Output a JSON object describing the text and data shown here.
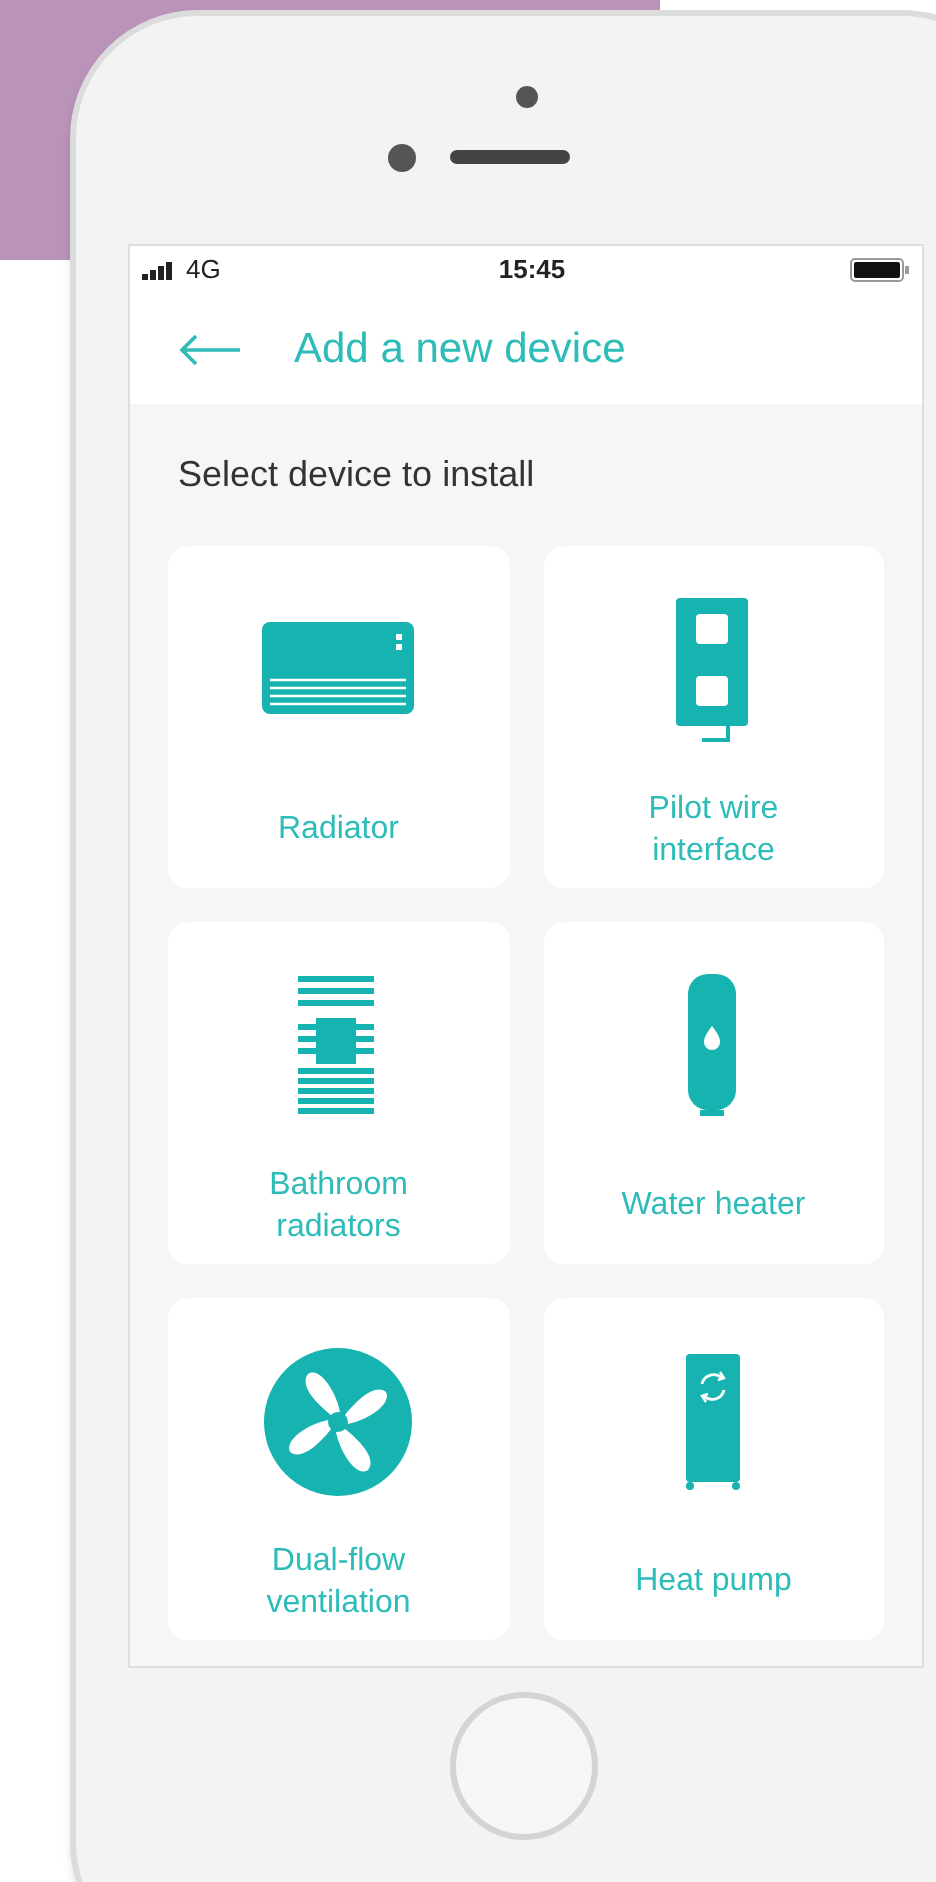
{
  "status_bar": {
    "network": "4G",
    "time": "15:45"
  },
  "header": {
    "title": "Add a new device"
  },
  "section_title": "Select device to install",
  "devices": [
    {
      "kind": "radiator",
      "label": "Radiator"
    },
    {
      "kind": "pilot_wire",
      "label": "Pilot wire interface"
    },
    {
      "kind": "towel_radiator",
      "label": "Bathroom radiators"
    },
    {
      "kind": "water_heater",
      "label": "Water heater"
    },
    {
      "kind": "fan",
      "label": "Dual-flow ventilation"
    },
    {
      "kind": "heat_pump",
      "label": "Heat pump"
    }
  ]
}
